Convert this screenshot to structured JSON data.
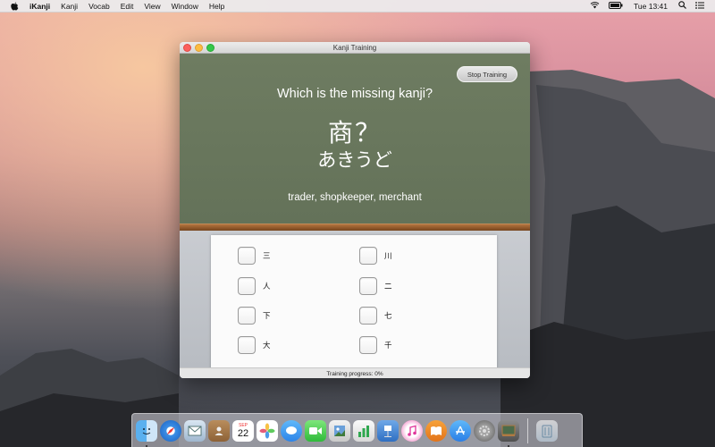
{
  "menubar": {
    "app_name": "iKanji",
    "menus": [
      "Kanji",
      "Vocab",
      "Edit",
      "View",
      "Window",
      "Help"
    ],
    "clock": "Tue 13:41"
  },
  "window": {
    "title": "Kanji Training",
    "stop_button": "Stop Training",
    "question": "Which is the missing kanji?",
    "kanji": "商？",
    "reading": "あきうど",
    "meaning": "trader, shopkeeper, merchant",
    "choices_left": [
      "三",
      "人",
      "下",
      "大"
    ],
    "choices_right": [
      "川",
      "二",
      "七",
      "千"
    ],
    "status": "Training progress: 0%"
  },
  "dock": {
    "items": [
      "finder-icon",
      "safari-icon",
      "mail-icon",
      "contacts-icon",
      "calendar-icon",
      "photos-icon",
      "messages-icon",
      "facetime-icon",
      "preview-icon",
      "numbers-icon",
      "keynote-icon",
      "itunes-icon",
      "ibooks-icon",
      "app-store-icon",
      "system-preferences-icon",
      "ikanji-icon",
      "trash-icon"
    ],
    "calendar_day": "22",
    "calendar_month": "SEP"
  },
  "colors": {
    "chalkboard": "#6b785e",
    "ledge": "#8a5326"
  }
}
